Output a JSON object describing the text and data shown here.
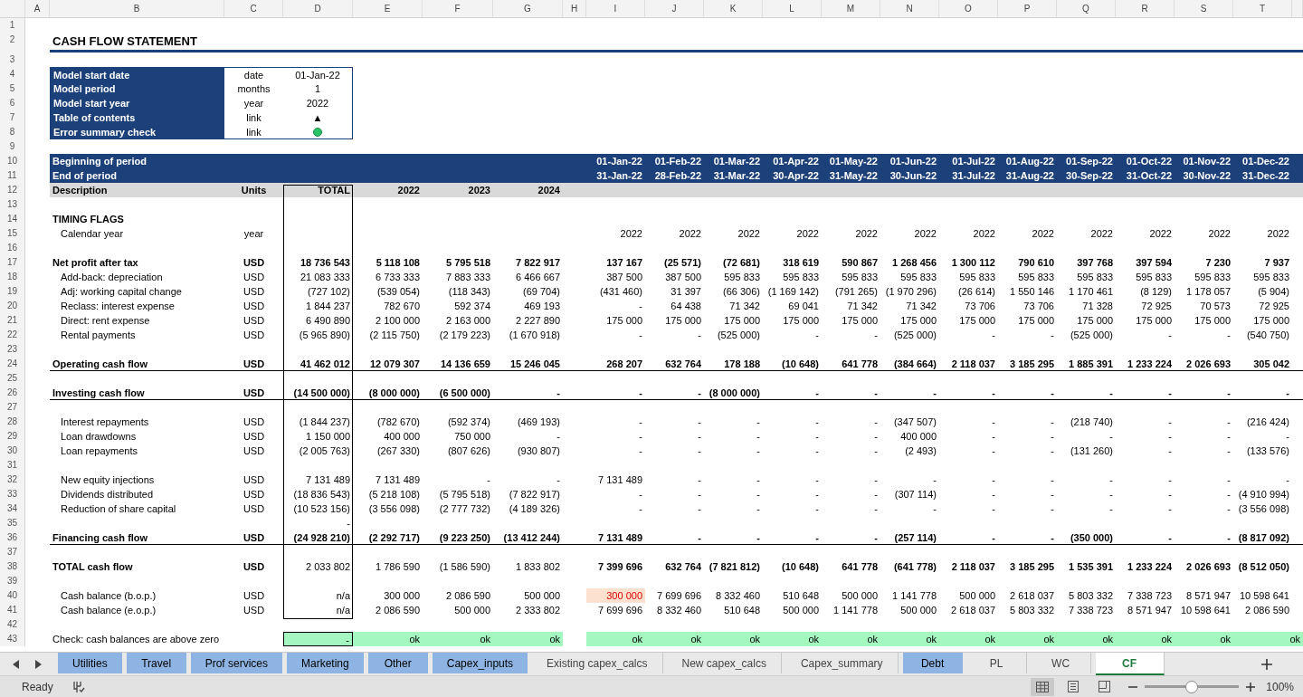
{
  "column_headers": [
    "A",
    "B",
    "C",
    "D",
    "E",
    "F",
    "G",
    "H",
    "I",
    "J",
    "K",
    "L",
    "M",
    "N",
    "O",
    "P",
    "Q",
    "R",
    "S",
    "T"
  ],
  "row_numbers": [
    "1",
    "2",
    "3",
    "4",
    "5",
    "6",
    "7",
    "8",
    "9",
    "10",
    "11",
    "12",
    "13",
    "14",
    "15",
    "16",
    "17",
    "18",
    "19",
    "20",
    "21",
    "22",
    "23",
    "24",
    "25",
    "26",
    "27",
    "28",
    "29",
    "30",
    "31",
    "32",
    "33",
    "34",
    "35",
    "36",
    "37",
    "38",
    "39",
    "40",
    "41",
    "42",
    "43"
  ],
  "title": "CASH FLOW STATEMENT",
  "settings": [
    {
      "label": "Model start date",
      "unit": "date",
      "kind": "text",
      "value": "01-Jan-22"
    },
    {
      "label": "Model period",
      "unit": "months",
      "kind": "text",
      "value": "1"
    },
    {
      "label": "Model start year",
      "unit": "year",
      "kind": "text",
      "value": "2022"
    },
    {
      "label": "Table of contents",
      "unit": "link",
      "kind": "text",
      "value": "▲"
    },
    {
      "label": "Error summary check",
      "unit": "link",
      "kind": "dot",
      "color": "#27c26a"
    }
  ],
  "period_header": {
    "begin_label": "Beginning of period",
    "end_label": "End of period",
    "begin_dates": [
      "01-Jan-22",
      "01-Feb-22",
      "01-Mar-22",
      "01-Apr-22",
      "01-May-22",
      "01-Jun-22",
      "01-Jul-22",
      "01-Aug-22",
      "01-Sep-22",
      "01-Oct-22",
      "01-Nov-22",
      "01-Dec-22"
    ],
    "end_dates": [
      "31-Jan-22",
      "28-Feb-22",
      "31-Mar-22",
      "30-Apr-22",
      "31-May-22",
      "30-Jun-22",
      "31-Jul-22",
      "31-Aug-22",
      "30-Sep-22",
      "31-Oct-22",
      "30-Nov-22",
      "31-Dec-22"
    ]
  },
  "column_titles": {
    "description": "Description",
    "units": "Units",
    "total": "TOTAL",
    "years": [
      "2022",
      "2023",
      "2024"
    ]
  },
  "lines": [
    {
      "kind": "spacer"
    },
    {
      "kind": "heading",
      "label": "TIMING FLAGS"
    },
    {
      "kind": "item",
      "label": "Calendar year",
      "unit": "year",
      "months": [
        "2022",
        "2022",
        "2022",
        "2022",
        "2022",
        "2022",
        "2022",
        "2022",
        "2022",
        "2022",
        "2022",
        "2022"
      ]
    },
    {
      "kind": "spacer"
    },
    {
      "kind": "bold",
      "label": "Net profit after tax",
      "unit": "USD",
      "total": "18 736 543",
      "years": [
        "5 118 108",
        "5 795 518",
        "7 822 917"
      ],
      "months": [
        "137 167",
        "(25 571)",
        "(72 681)",
        "318 619",
        "590 867",
        "1 268 456",
        "1 300 112",
        "790 610",
        "397 768",
        "397 594",
        "7 230",
        "7 937"
      ]
    },
    {
      "kind": "item",
      "label": "Add-back: depreciation",
      "unit": "USD",
      "total": "21 083 333",
      "years": [
        "6 733 333",
        "7 883 333",
        "6 466 667"
      ],
      "months": [
        "387 500",
        "387 500",
        "595 833",
        "595 833",
        "595 833",
        "595 833",
        "595 833",
        "595 833",
        "595 833",
        "595 833",
        "595 833",
        "595 833"
      ]
    },
    {
      "kind": "item",
      "label": "Adj: working capital change",
      "unit": "USD",
      "total": "(727 102)",
      "years": [
        "(539 054)",
        "(118 343)",
        "(69 704)"
      ],
      "months": [
        "(431 460)",
        "31 397",
        "(66 306)",
        "(1 169 142)",
        "(791 265)",
        "(1 970 296)",
        "(26 614)",
        "1 550 146",
        "1 170 461",
        "(8 129)",
        "1 178 057",
        "(5 904)"
      ]
    },
    {
      "kind": "item",
      "label": "Reclass: interest expense",
      "unit": "USD",
      "total": "1 844 237",
      "years": [
        "782 670",
        "592 374",
        "469 193"
      ],
      "months": [
        "-",
        "64 438",
        "71 342",
        "69 041",
        "71 342",
        "71 342",
        "73 706",
        "73 706",
        "71 328",
        "72 925",
        "70 573",
        "72 925"
      ]
    },
    {
      "kind": "item",
      "label": "Direct: rent expense",
      "unit": "USD",
      "total": "6 490 890",
      "years": [
        "2 100 000",
        "2 163 000",
        "2 227 890"
      ],
      "months": [
        "175 000",
        "175 000",
        "175 000",
        "175 000",
        "175 000",
        "175 000",
        "175 000",
        "175 000",
        "175 000",
        "175 000",
        "175 000",
        "175 000"
      ]
    },
    {
      "kind": "item",
      "label": "Rental payments",
      "unit": "USD",
      "total": "(5 965 890)",
      "years": [
        "(2 115 750)",
        "(2 179 223)",
        "(1 670 918)"
      ],
      "months": [
        "-",
        "-",
        "(525 000)",
        "-",
        "-",
        "(525 000)",
        "-",
        "-",
        "(525 000)",
        "-",
        "-",
        "(540 750)"
      ]
    },
    {
      "kind": "spacer"
    },
    {
      "kind": "subtotal",
      "label": "Operating cash flow",
      "unit": "USD",
      "total": "41 462 012",
      "years": [
        "12 079 307",
        "14 136 659",
        "15 246 045"
      ],
      "months": [
        "268 207",
        "632 764",
        "178 188",
        "(10 648)",
        "641 778",
        "(384 664)",
        "2 118 037",
        "3 185 295",
        "1 885 391",
        "1 233 224",
        "2 026 693",
        "305 042"
      ]
    },
    {
      "kind": "spacer"
    },
    {
      "kind": "subtotal",
      "label": "Investing cash flow",
      "unit": "USD",
      "total": "(14 500 000)",
      "years": [
        "(8 000 000)",
        "(6 500 000)",
        "-"
      ],
      "months": [
        "-",
        "-",
        "(8 000 000)",
        "-",
        "-",
        "-",
        "-",
        "-",
        "-",
        "-",
        "-",
        "-"
      ]
    },
    {
      "kind": "spacer"
    },
    {
      "kind": "item",
      "label": "Interest repayments",
      "unit": "USD",
      "total": "(1 844 237)",
      "years": [
        "(782 670)",
        "(592 374)",
        "(469 193)"
      ],
      "months": [
        "-",
        "-",
        "-",
        "-",
        "-",
        "(347 507)",
        "-",
        "-",
        "(218 740)",
        "-",
        "-",
        "(216 424)"
      ]
    },
    {
      "kind": "item",
      "label": "Loan drawdowns",
      "unit": "USD",
      "total": "1 150 000",
      "years": [
        "400 000",
        "750 000",
        "-"
      ],
      "months": [
        "-",
        "-",
        "-",
        "-",
        "-",
        "400 000",
        "-",
        "-",
        "-",
        "-",
        "-",
        "-"
      ]
    },
    {
      "kind": "item",
      "label": "Loan repayments",
      "unit": "USD",
      "total": "(2 005 763)",
      "years": [
        "(267 330)",
        "(807 626)",
        "(930 807)"
      ],
      "months": [
        "-",
        "-",
        "-",
        "-",
        "-",
        "(2 493)",
        "-",
        "-",
        "(131 260)",
        "-",
        "-",
        "(133 576)"
      ]
    },
    {
      "kind": "spacer"
    },
    {
      "kind": "item",
      "label": "New equity injections",
      "unit": "USD",
      "total": "7 131 489",
      "years": [
        "7 131 489",
        "-",
        "-"
      ],
      "months": [
        "7 131 489",
        "-",
        "-",
        "-",
        "-",
        "-",
        "-",
        "-",
        "-",
        "-",
        "-",
        "-"
      ]
    },
    {
      "kind": "item",
      "label": "Dividends distributed",
      "unit": "USD",
      "total": "(18 836 543)",
      "years": [
        "(5 218 108)",
        "(5 795 518)",
        "(7 822 917)"
      ],
      "months": [
        "-",
        "-",
        "-",
        "-",
        "-",
        "(307 114)",
        "-",
        "-",
        "-",
        "-",
        "-",
        "(4 910 994)"
      ]
    },
    {
      "kind": "item",
      "label": "Reduction of share capital",
      "unit": "USD",
      "total": "(10 523 156)",
      "years": [
        "(3 556 098)",
        "(2 777 732)",
        "(4 189 326)"
      ],
      "months": [
        "-",
        "-",
        "-",
        "-",
        "-",
        "-",
        "-",
        "-",
        "-",
        "-",
        "-",
        "(3 556 098)"
      ]
    },
    {
      "kind": "item",
      "total": "-"
    },
    {
      "kind": "subtotal",
      "label": "Financing cash flow",
      "unit": "USD",
      "total": "(24 928 210)",
      "years": [
        "(2 292 717)",
        "(9 223 250)",
        "(13 412 244)"
      ],
      "months": [
        "7 131 489",
        "-",
        "-",
        "-",
        "-",
        "(257 114)",
        "-",
        "-",
        "(350 000)",
        "-",
        "-",
        "(8 817 092)"
      ]
    },
    {
      "kind": "spacer"
    },
    {
      "kind": "grand",
      "label": "TOTAL cash flow",
      "unit": "USD",
      "total": "2 033 802",
      "years": [
        "1 786 590",
        "(1 586 590)",
        "1 833 802"
      ],
      "months": [
        "7 399 696",
        "632 764",
        "(7 821 812)",
        "(10 648)",
        "641 778",
        "(641 778)",
        "2 118 037",
        "3 185 295",
        "1 535 391",
        "1 233 224",
        "2 026 693",
        "(8 512 050)"
      ]
    },
    {
      "kind": "spacer"
    },
    {
      "kind": "item",
      "label": "Cash balance (b.o.p.)",
      "unit": "USD",
      "total": "n/a",
      "years": [
        "300 000",
        "2 086 590",
        "500 000"
      ],
      "months": [
        "300 000",
        "7 699 696",
        "8 332 460",
        "510 648",
        "500 000",
        "1 141 778",
        "500 000",
        "2 618 037",
        "5 803 332",
        "7 338 723",
        "8 571 947",
        "10 598 641"
      ],
      "months_warning": [
        true,
        false,
        false,
        false,
        false,
        false,
        false,
        false,
        false,
        false,
        false,
        false
      ]
    },
    {
      "kind": "item",
      "label": "Cash balance (e.o.p.)",
      "unit": "USD",
      "total": "n/a",
      "years": [
        "2 086 590",
        "500 000",
        "2 333 802"
      ],
      "months": [
        "7 699 696",
        "8 332 460",
        "510 648",
        "500 000",
        "1 141 778",
        "500 000",
        "2 618 037",
        "5 803 332",
        "7 338 723",
        "8 571 947",
        "10 598 641",
        "2 086 590"
      ]
    },
    {
      "kind": "spacer"
    },
    {
      "kind": "check",
      "label": "Check: cash balances are above zero",
      "passed": true,
      "total": "-",
      "years": [
        "ok",
        "ok",
        "ok"
      ],
      "months": [
        "ok",
        "ok",
        "ok",
        "ok",
        "ok",
        "ok",
        "ok",
        "ok",
        "ok",
        "ok",
        "ok",
        "ok"
      ]
    }
  ],
  "sheet_tabs": [
    {
      "label": "Utilities",
      "selected": false,
      "color": "#8db4e2"
    },
    {
      "label": "Travel",
      "selected": false,
      "color": "#8db4e2"
    },
    {
      "label": "Prof services",
      "selected": false,
      "color": "#8db4e2"
    },
    {
      "label": "Marketing",
      "selected": false,
      "color": "#8db4e2"
    },
    {
      "label": "Other",
      "selected": false,
      "color": "#8db4e2"
    },
    {
      "label": "Capex_inputs",
      "selected": false,
      "color": "#8db4e2"
    },
    {
      "label": "Existing capex_calcs",
      "selected": false
    },
    {
      "label": "New capex_calcs",
      "selected": false
    },
    {
      "label": "Capex_summary",
      "selected": false
    },
    {
      "label": "Debt",
      "selected": false,
      "color": "#8db4e2"
    },
    {
      "label": "PL",
      "selected": false
    },
    {
      "label": "WC",
      "selected": false
    },
    {
      "label": "CF",
      "selected": true
    }
  ],
  "status_bar": {
    "mode": "Ready",
    "views": [
      {
        "kind": "normal",
        "selected": true
      },
      {
        "kind": "page-layout",
        "selected": false
      },
      {
        "kind": "page-break",
        "selected": false
      }
    ],
    "zoom": {
      "level": 0.5,
      "reading": "100%"
    }
  }
}
